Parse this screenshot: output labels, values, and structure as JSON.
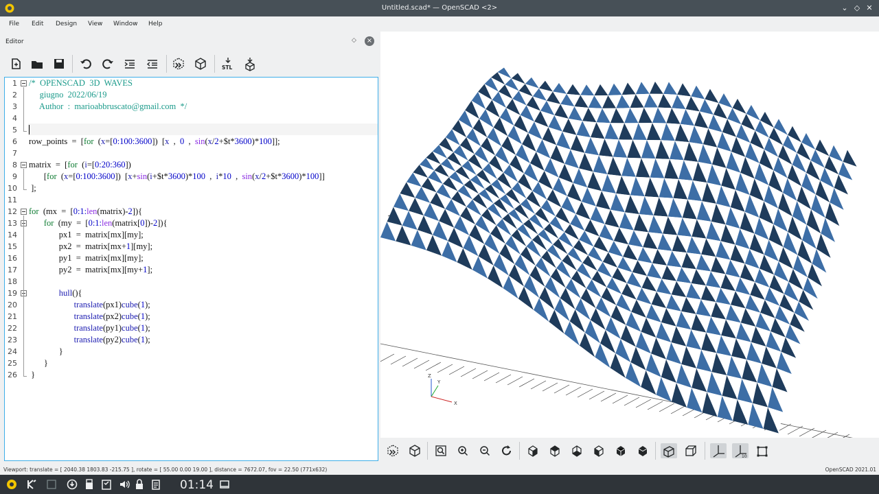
{
  "window": {
    "title": "Untitled.scad* — OpenSCAD <2>"
  },
  "menu": [
    "File",
    "Edit",
    "Design",
    "View",
    "Window",
    "Help"
  ],
  "editor": {
    "title": "Editor",
    "lines": [
      "1",
      "2",
      "3",
      "4",
      "5",
      "6",
      "7",
      "8",
      "9",
      "10",
      "11",
      "12",
      "13",
      "14",
      "15",
      "16",
      "17",
      "18",
      "19",
      "20",
      "21",
      "22",
      "23",
      "24",
      "25",
      "26"
    ]
  },
  "status": {
    "viewport": "Viewport: translate = [ 2040.38 1803.83 -215.75 ], rotate = [ 55.00 0.00 19.00 ], distance = 7672.07, fov = 22.50 (771x632)",
    "version": "OpenSCAD 2021.01"
  },
  "taskbar": {
    "clock": "01:14"
  },
  "axis_labels": {
    "z": "Z",
    "y": "Y",
    "x": "X"
  },
  "colors": {
    "mesh_dark": "#1f3c5c",
    "mesh_light": "#3d6ea6",
    "accent": "#3daee9"
  },
  "icons": {
    "editor_toolbar": [
      "new-file-icon",
      "open-file-icon",
      "save-file-icon",
      "undo-icon",
      "redo-icon",
      "indent-icon",
      "unindent-icon",
      "preview-icon",
      "render-icon",
      "export-stl-icon",
      "send-to-print-icon"
    ],
    "viewer_toolbar": [
      "preview-icon",
      "render-icon",
      "view-all-icon",
      "zoom-in-icon",
      "zoom-out-icon",
      "reset-view-icon",
      "view-right-icon",
      "view-top-icon",
      "view-bottom-icon",
      "view-left-icon",
      "view-front-icon",
      "view-back-icon",
      "perspective-icon",
      "orthogonal-icon",
      "show-axes-icon",
      "show-scale-markers-icon",
      "show-edges-icon"
    ]
  }
}
